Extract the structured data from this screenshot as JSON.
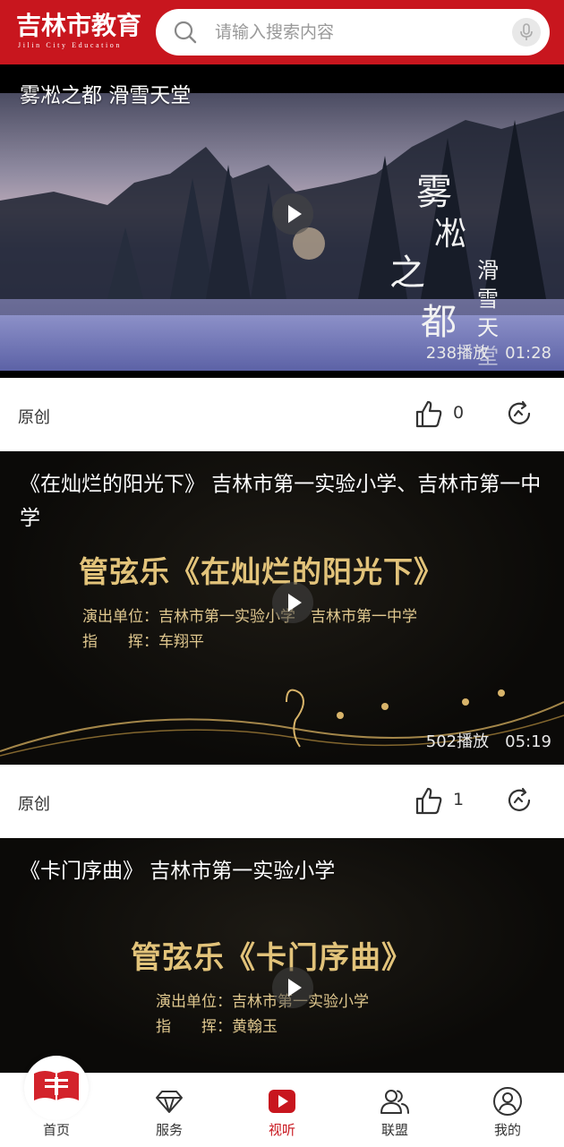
{
  "header": {
    "logo_cn": "吉林市教育",
    "logo_en": "Jilin City Education",
    "search_placeholder": "请输入搜索内容"
  },
  "feed": [
    {
      "title": "雾凇之都 滑雪天堂",
      "overlay_text": [
        "雾",
        "凇",
        "之",
        "都",
        "滑",
        "雪",
        "天",
        "堂"
      ],
      "plays": "238播放",
      "duration": "01:28",
      "tag": "原创",
      "likes": "0"
    },
    {
      "title": "《在灿烂的阳光下》 吉林市第一实验小学、吉林市第一中学",
      "poster_title": "管弦乐《在灿烂的阳光下》",
      "poster_unit": "演出单位：吉林市第一实验小学　吉林市第一中学",
      "poster_conductor": "指　　挥：车翔平",
      "plays": "502播放",
      "duration": "05:19",
      "tag": "原创",
      "likes": "1"
    },
    {
      "title": "《卡门序曲》 吉林市第一实验小学",
      "poster_title": "管弦乐《卡门序曲》",
      "poster_unit": "演出单位：吉林市第一实验小学",
      "poster_conductor": "指　　挥：黄翰玉"
    }
  ],
  "tabs": [
    {
      "label": "首页",
      "icon": "home-book-icon"
    },
    {
      "label": "服务",
      "icon": "diamond-icon"
    },
    {
      "label": "视听",
      "icon": "play-icon",
      "active": true
    },
    {
      "label": "联盟",
      "icon": "people-icon"
    },
    {
      "label": "我的",
      "icon": "user-icon"
    }
  ],
  "colors": {
    "brand_red": "#c8161e",
    "gold": "#e2c37a"
  }
}
